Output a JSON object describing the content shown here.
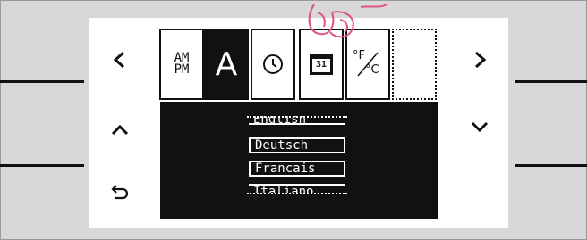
{
  "tabs": [
    {
      "name": "ampm",
      "label_line1": "AM",
      "label_line2": "PM"
    },
    {
      "name": "language",
      "label": "A"
    },
    {
      "name": "clock",
      "icon": "clock-icon"
    },
    {
      "name": "date",
      "label": "31",
      "icon": "calendar-icon"
    },
    {
      "name": "temperature-unit",
      "label_f": "°F",
      "label_c": "°C"
    },
    {
      "name": "empty-slot"
    }
  ],
  "languages": {
    "items": [
      "English",
      "Deutsch",
      "Francais",
      "Italiano"
    ],
    "selected": "Deutsch"
  },
  "nav": {
    "prev_icon": "chevron-left-icon",
    "next_icon": "chevron-right-icon",
    "up_icon": "chevron-up-icon",
    "down_icon": "chevron-down-icon",
    "back_icon": "back-arrow-icon"
  },
  "colors": {
    "background": "#d8d8d8",
    "panel": "#ffffff",
    "ink": "#111111",
    "stamp": "#e0508a"
  }
}
